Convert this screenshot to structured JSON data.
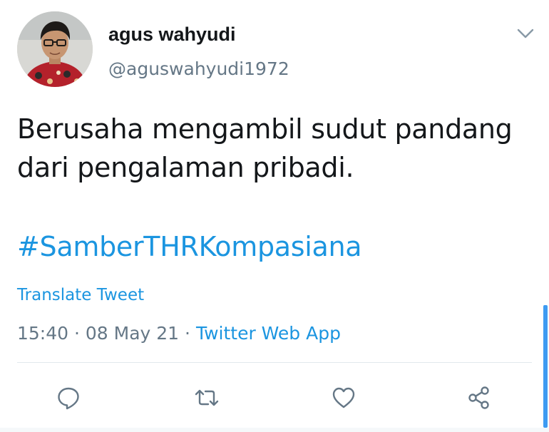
{
  "author": {
    "display_name": "agus wahyudi",
    "handle": "@aguswahyudi1972"
  },
  "tweet": {
    "text_line1": "Berusaha mengambil sudut pandang",
    "text_line2": "dari pengalaman pribadi.",
    "hashtag": "#SamberTHRKompasiana",
    "translate_label": "Translate Tweet",
    "time": "15:40",
    "separator": " · ",
    "date": "08 May 21",
    "source": "Twitter Web App"
  },
  "actions": {
    "reply_icon": "reply-icon",
    "retweet_icon": "retweet-icon",
    "like_icon": "heart-icon",
    "share_icon": "share-icon"
  },
  "colors": {
    "link": "#1b95e0",
    "secondary_text": "#657786",
    "primary_text": "#14171a",
    "icon": "#657786"
  }
}
